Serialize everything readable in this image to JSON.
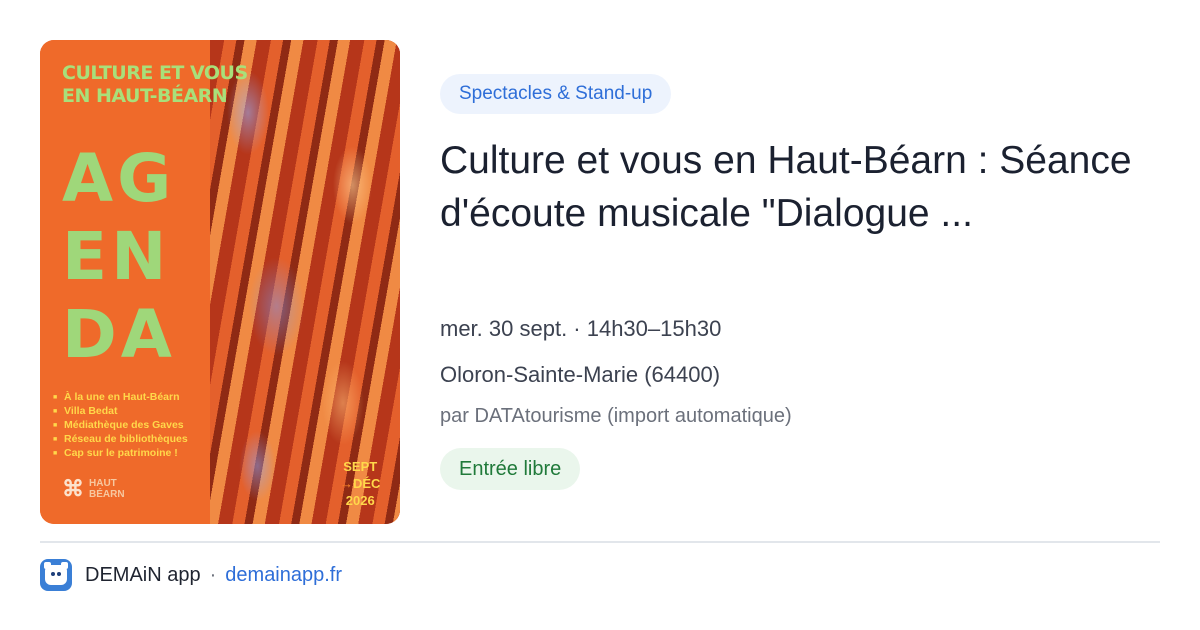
{
  "poster": {
    "title_line1": "CULTURE ET VOUS",
    "title_line2": "EN HAUT-BÉARN",
    "agenda_lines": [
      "AG",
      "EN",
      "DA"
    ],
    "items": [
      "À la une en Haut-Béarn",
      "Villa Bedat",
      "Médiathèque des Gaves",
      "Réseau de bibliothèques",
      "Cap sur le patrimoine !"
    ],
    "logo_text_line1": "HAUT",
    "logo_text_line2": "BÉARN",
    "date_line1": "SEPT",
    "date_line2": "DÉC",
    "date_line3": "2026"
  },
  "event": {
    "category": "Spectacles & Stand-up",
    "title": "Culture et vous en Haut-Béarn : Séance d'écoute musicale \"Dialogue ...",
    "datetime": "mer. 30 sept. · 14h30–15h30",
    "location": "Oloron-Sainte-Marie (64400)",
    "source": "par DATAtourisme (import automatique)",
    "price": "Entrée libre"
  },
  "footer": {
    "app_name": "DEMAiN app",
    "separator": "·",
    "domain": "demainapp.fr"
  },
  "colors": {
    "accent_blue": "#2e6ed8",
    "chip_bg": "#edf3fd",
    "price_green": "#207a3a",
    "price_bg": "#eaf6ec",
    "poster_orange": "#ef6a2a",
    "poster_green": "#9fd77a"
  }
}
